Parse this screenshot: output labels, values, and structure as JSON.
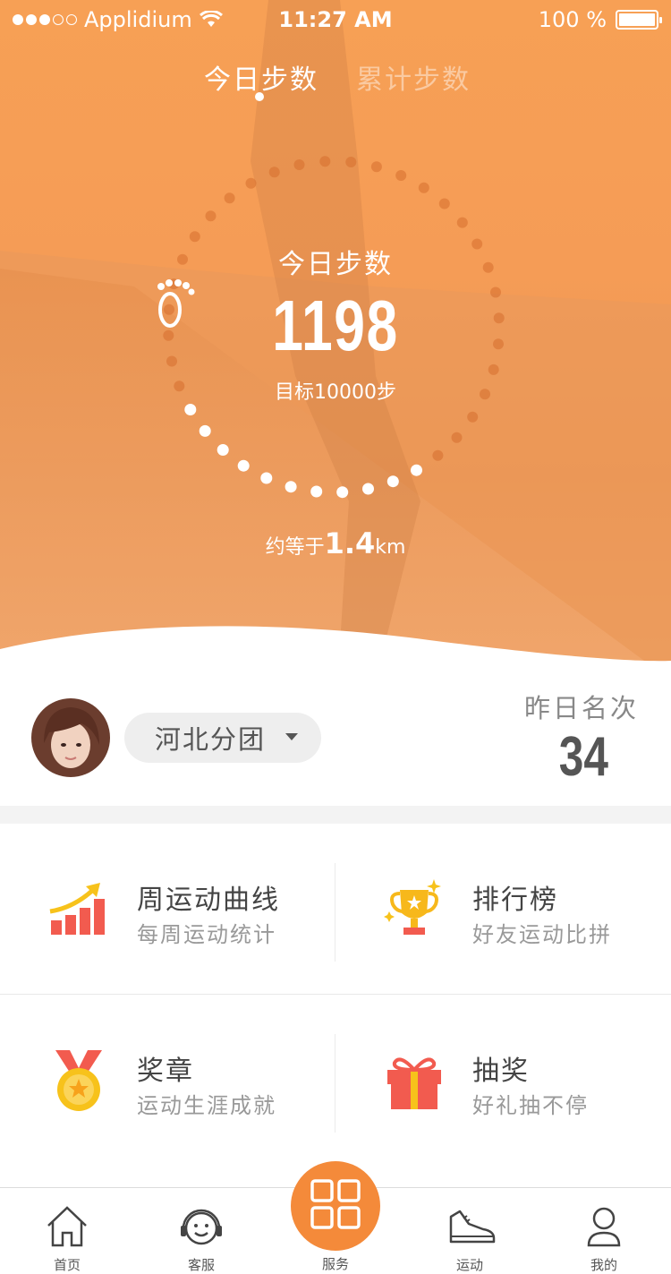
{
  "status": {
    "carrier": "Applidium",
    "time": "11:27 AM",
    "battery": "100 %"
  },
  "tabs": {
    "active": "今日步数",
    "inactive": "累计步数"
  },
  "steps": {
    "label": "今日步数",
    "value": "1198",
    "goal": "目标10000步",
    "progress_fraction": 0.12
  },
  "distance": {
    "prefix": "约等于",
    "value": "1.4",
    "unit": "km"
  },
  "profile": {
    "group": "河北分团",
    "rank_label": "昨日名次",
    "rank_value": "34"
  },
  "grid": [
    {
      "title": "周运动曲线",
      "sub": "每周运动统计",
      "icon": "chart-up-icon"
    },
    {
      "title": "排行榜",
      "sub": "好友运动比拼",
      "icon": "trophy-icon"
    },
    {
      "title": "奖章",
      "sub": "运动生涯成就",
      "icon": "medal-icon"
    },
    {
      "title": "抽奖",
      "sub": "好礼抽不停",
      "icon": "gift-icon"
    }
  ],
  "tabbar": [
    {
      "label": "首页",
      "icon": "home-icon"
    },
    {
      "label": "客服",
      "icon": "headset-icon"
    },
    {
      "label": "服务",
      "icon": "grid-icon"
    },
    {
      "label": "运动",
      "icon": "sneaker-icon"
    },
    {
      "label": "我的",
      "icon": "user-icon"
    }
  ],
  "colors": {
    "accent": "#f48a3a",
    "hero": "#f59c56"
  }
}
